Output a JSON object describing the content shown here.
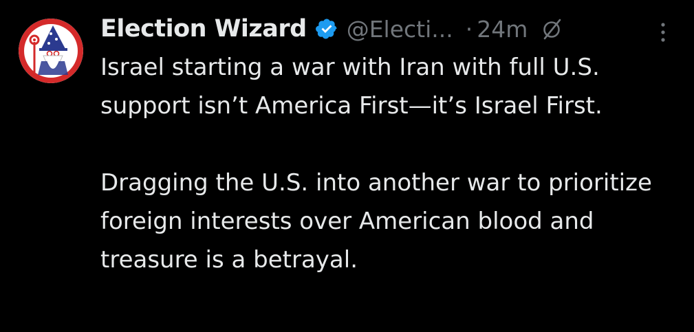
{
  "tweet": {
    "author": {
      "display_name": "Election Wizard",
      "handle": "@Electi...",
      "verified": true,
      "verified_color": "#1d9bf0",
      "avatar_icon": "wizard-avatar-icon"
    },
    "separator": "·",
    "timestamp": "24m",
    "paragraphs": [
      "Israel starting a war with Iran with full U.S. support isn’t America First—it’s Israel First.",
      "Dragging the U.S. into another war to prioritize foreign interests over American blood and treasure is a betrayal."
    ],
    "icons": {
      "verified": "verified-badge-icon",
      "grok": "grok-icon",
      "more": "more-options-icon"
    }
  },
  "colors": {
    "background": "#000000",
    "text_primary": "#e7e9ea",
    "text_secondary": "#71767b",
    "avatar_red": "#d42a2a",
    "avatar_blue": "#2b3a8f"
  }
}
